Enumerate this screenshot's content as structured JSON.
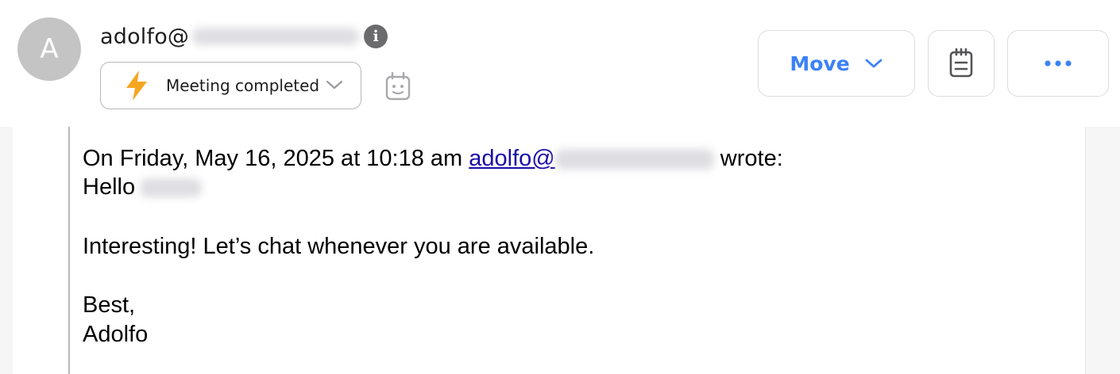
{
  "header": {
    "avatar_initial": "A",
    "sender_prefix": "adolfo@",
    "status": {
      "label": "Meeting completed"
    },
    "actions": {
      "move_label": "Move"
    }
  },
  "message": {
    "quote_intro": "On Friday, May 16, 2025 at 10:18 am",
    "quote_link_prefix": "adolfo@",
    "quote_suffix": "wrote:",
    "greeting": "Hello",
    "body": "Interesting! Let’s chat whenever you are available.",
    "signoff": "Best,",
    "signature": "Adolfo"
  },
  "colors": {
    "accent": "#3b82f6",
    "bolt": "#f5a623",
    "link": "#1a0dab"
  },
  "icons": [
    "info-icon",
    "bolt-icon",
    "chevron-down-icon",
    "bot-icon",
    "notepad-icon",
    "more-icon"
  ]
}
